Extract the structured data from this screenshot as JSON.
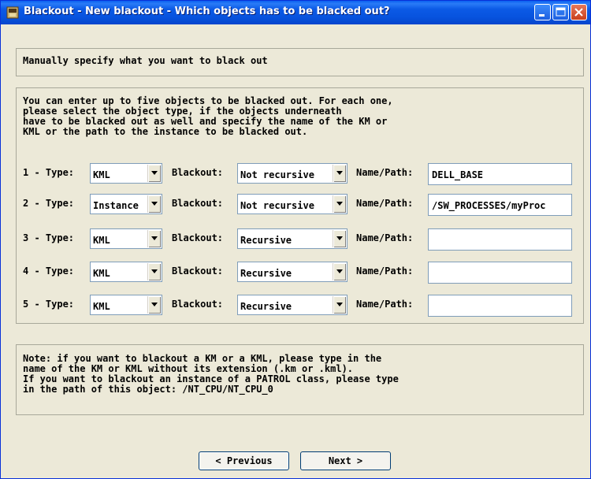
{
  "window": {
    "title": "Blackout - New blackout - Which objects has to be blacked out?"
  },
  "header": {
    "text": "Manually specify what you want to black out"
  },
  "intro": "You can enter up to five objects to be blacked out. For each one,\nplease select the object type, if the objects underneath\nhave to be blacked out as well and specify the name of the KM or\nKML or the path to the instance to be blacked out.",
  "labels": {
    "blackout": "Blackout:",
    "name_path": "Name/Path:"
  },
  "rows": [
    {
      "label": "1 - Type:",
      "type": "KML",
      "blackout": "Not recursive",
      "name": "DELL_BASE"
    },
    {
      "label": "2 - Type:",
      "type": "Instance",
      "blackout": "Not recursive",
      "name": "/SW_PROCESSES/myProc"
    },
    {
      "label": "3 - Type:",
      "type": "KML",
      "blackout": "Recursive",
      "name": ""
    },
    {
      "label": "4 - Type:",
      "type": "KML",
      "blackout": "Recursive",
      "name": ""
    },
    {
      "label": "5 - Type:",
      "type": "KML",
      "blackout": "Recursive",
      "name": ""
    }
  ],
  "note": "Note: if you want to blackout a KM or a KML, please type in the\nname of the KM or KML without its extension (.km or .kml).\nIf you want to blackout an instance of a PATROL class, please type\nin the path of this object: /NT_CPU/NT_CPU_0",
  "buttons": {
    "previous": "< Previous",
    "next": "Next >"
  },
  "colors": {
    "titlebar": "#0753de",
    "background": "#ece9d8",
    "close": "#c9401c"
  }
}
